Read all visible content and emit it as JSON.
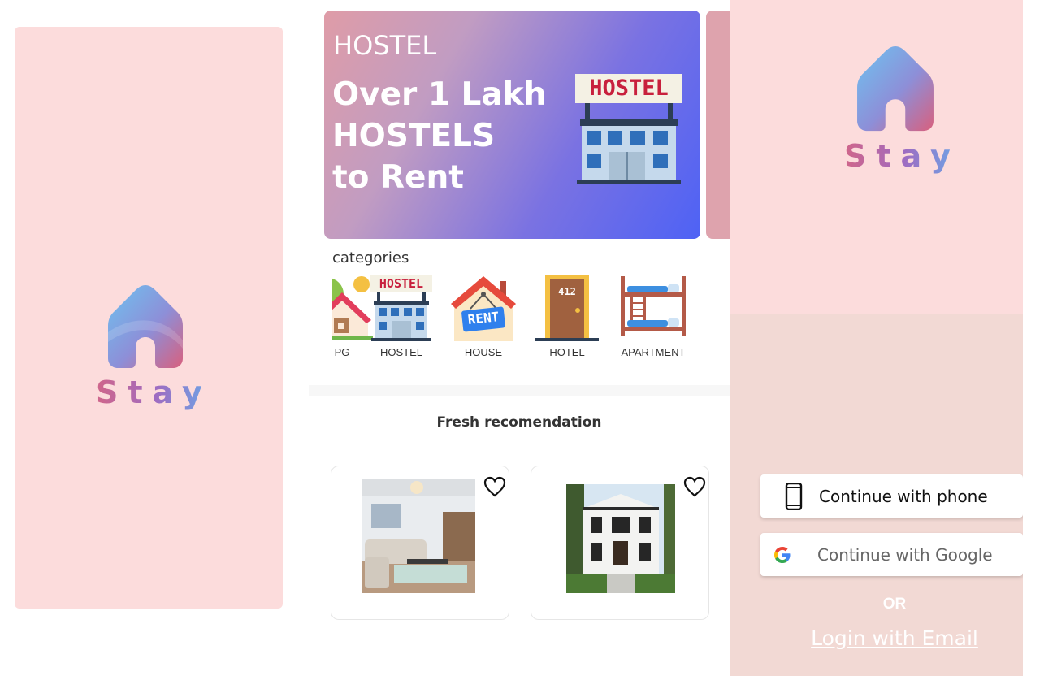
{
  "splash": {
    "logo_icon": "house-logo-icon",
    "brand": "Stay"
  },
  "home": {
    "banner": {
      "tag": "HOSTEL",
      "headline_line1": "Over 1 Lakh",
      "headline_line2": "HOSTELS",
      "headline_line3": "to Rent",
      "sign_text": "HOSTEL"
    },
    "categories_title": "categories",
    "categories": [
      {
        "label": "PG",
        "icon": "pg-house-icon"
      },
      {
        "label": "HOSTEL",
        "icon": "hostel-building-icon",
        "sign": "HOSTEL"
      },
      {
        "label": "HOUSE",
        "icon": "house-rent-icon",
        "sign": "RENT"
      },
      {
        "label": "HOTEL",
        "icon": "hotel-door-icon",
        "sign": "412"
      },
      {
        "label": "APARTMENT",
        "icon": "bunk-bed-icon"
      }
    ],
    "fresh_title": "Fresh recomendation",
    "fresh_cards": [
      {
        "image": "living-room-photo",
        "favorite_icon": "heart-outline-icon"
      },
      {
        "image": "modern-house-photo",
        "favorite_icon": "heart-outline-icon"
      }
    ]
  },
  "login": {
    "brand": "Stay",
    "phone_button": "Continue with phone",
    "google_button": "Continue with Google",
    "or_text": "OR",
    "email_link": "Login with Email"
  },
  "colors": {
    "splash_bg": "#fcdcdc",
    "login_bottom_bg": "#f2d9d4",
    "banner_start": "#df9ca7",
    "banner_end": "#4e62f5"
  }
}
